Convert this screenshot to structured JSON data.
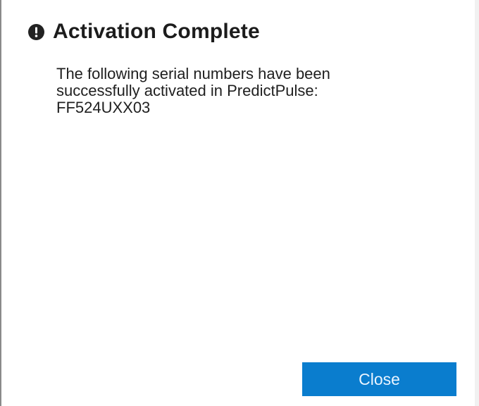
{
  "dialog": {
    "title": "Activation Complete",
    "icon": "exclamation-circle-icon",
    "message_line1": "The following serial numbers have been",
    "message_line2": "successfully activated in PredictPulse:",
    "serial_number": "FF524UXX03",
    "close_label": "Close"
  },
  "colors": {
    "accent": "#0a7dce",
    "text": "#1c1c1c"
  }
}
